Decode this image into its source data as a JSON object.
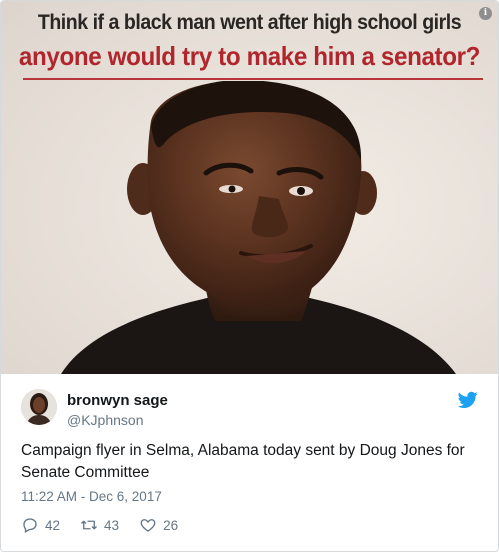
{
  "media": {
    "headline_line1": "Think if a black man went after high school girls",
    "headline_line2": "anyone would try to make him a senator?",
    "info_icon": "info-icon"
  },
  "tweet": {
    "display_name": "bronwyn sage",
    "handle": "@KJphnson",
    "text": "Campaign flyer in Selma, Alabama today sent by Doug Jones for Senate Committee",
    "timestamp": "11:22 AM - Dec 6, 2017",
    "brand_icon": "twitter-bird-icon",
    "brand_color": "#1da1f2",
    "actions": {
      "reply_count": "42",
      "retweet_count": "43",
      "like_count": "26"
    }
  }
}
